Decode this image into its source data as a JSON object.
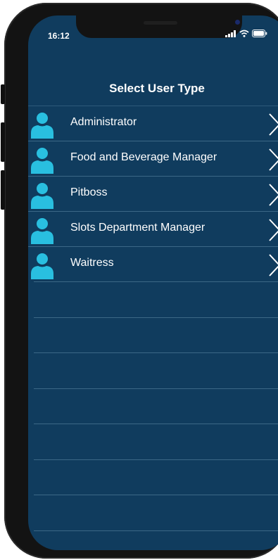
{
  "status_bar": {
    "time": "16:12",
    "icons": [
      "signal-icon",
      "wifi-icon",
      "battery-icon"
    ]
  },
  "header": {
    "title": "Select User Type"
  },
  "user_types": [
    {
      "label": "Administrator",
      "icon": "user-icon",
      "action": "chevron-right-icon"
    },
    {
      "label": "Food and Beverage Manager",
      "icon": "user-icon",
      "action": "chevron-right-icon"
    },
    {
      "label": "Pitboss",
      "icon": "user-icon",
      "action": "chevron-right-icon"
    },
    {
      "label": "Slots Department Manager",
      "icon": "user-icon",
      "action": "chevron-right-icon"
    },
    {
      "label": "Waitress",
      "icon": "user-icon",
      "action": "chevron-right-icon"
    }
  ],
  "colors": {
    "background": "#103c5e",
    "separator": "#3c6886",
    "avatar": "#29bfe0",
    "text": "#ffffff"
  }
}
